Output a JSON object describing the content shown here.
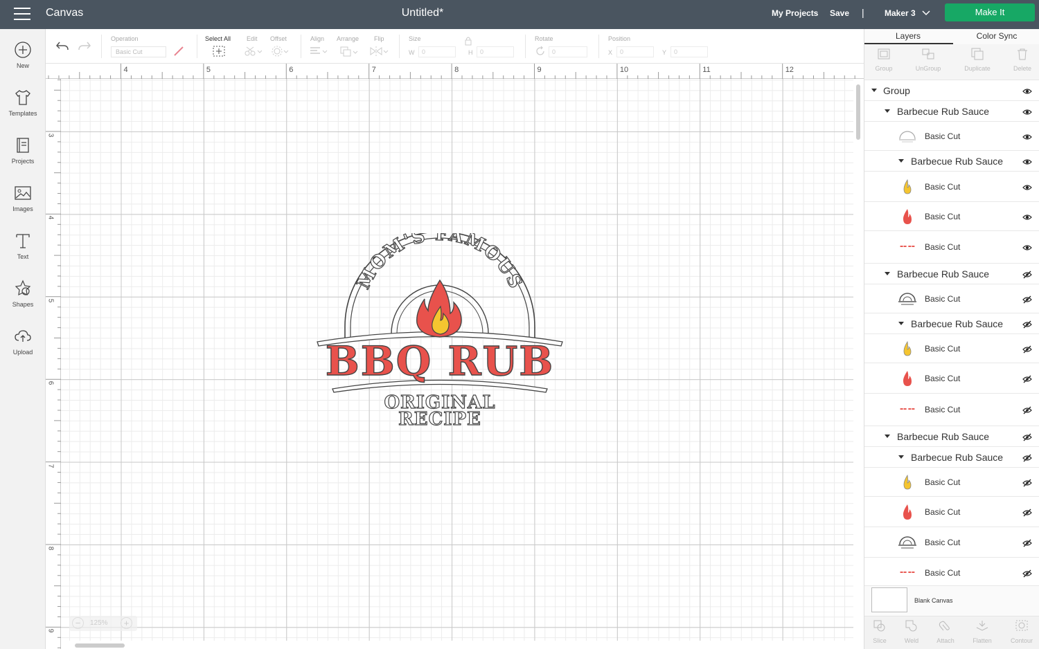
{
  "topbar": {
    "app_title": "Canvas",
    "doc_title": "Untitled*",
    "my_projects": "My Projects",
    "save": "Save",
    "separator": "|",
    "machine": "Maker 3",
    "make_it": "Make It",
    "make_it_color": "#17a865",
    "bar_color": "#4a5560"
  },
  "sidebar": {
    "items": [
      {
        "label": "New",
        "icon": "plus-circle-icon"
      },
      {
        "label": "Templates",
        "icon": "tshirt-icon"
      },
      {
        "label": "Projects",
        "icon": "book-icon"
      },
      {
        "label": "Images",
        "icon": "image-icon"
      },
      {
        "label": "Text",
        "icon": "text-t-icon"
      },
      {
        "label": "Shapes",
        "icon": "shapes-icon"
      },
      {
        "label": "Upload",
        "icon": "cloud-upload-icon"
      }
    ]
  },
  "toolbar": {
    "operation_label": "Operation",
    "operation_value": "Basic Cut",
    "select_all": "Select All",
    "edit": "Edit",
    "offset": "Offset",
    "align": "Align",
    "arrange": "Arrange",
    "flip": "Flip",
    "size": "Size",
    "w_label": "W",
    "w_value": "0",
    "h_label": "H",
    "h_value": "0",
    "rotate": "Rotate",
    "rotate_value": "0",
    "position": "Position",
    "x_label": "X",
    "x_value": "0",
    "y_label": "Y",
    "y_value": "0"
  },
  "canvas": {
    "ruler_top": [
      "4",
      "5",
      "6",
      "7",
      "8",
      "9",
      "10",
      "11",
      "12"
    ],
    "ruler_left": [
      "3",
      "4",
      "5",
      "6",
      "7",
      "8",
      "9"
    ],
    "zoom": "125%",
    "zoom_minus": "−",
    "zoom_plus": "+",
    "design": {
      "arc_text": "MOM'S FAMOUS",
      "main_text": "BBQ RUB",
      "sub_text_1": "ORIGINAL",
      "sub_text_2": "RECIPE",
      "red": "#e8524c",
      "yellow": "#f5c530"
    }
  },
  "panel": {
    "tab_layers": "Layers",
    "tab_color_sync": "Color Sync",
    "actions": [
      "Group",
      "UnGroup",
      "Duplicate",
      "Delete"
    ],
    "layers": [
      {
        "name": "Group",
        "indent": 0,
        "type": "group",
        "visible": true
      },
      {
        "name": "Barbecue Rub Sauce",
        "indent": 1,
        "type": "group",
        "visible": true
      },
      {
        "name": "Basic Cut",
        "indent": 2,
        "type": "arch-white",
        "visible": true
      },
      {
        "name": "Barbecue Rub Sauce",
        "indent": 2,
        "type": "group",
        "visible": true
      },
      {
        "name": "Basic Cut",
        "indent": 2,
        "type": "flame-yellow",
        "visible": true
      },
      {
        "name": "Basic Cut",
        "indent": 2,
        "type": "flame-red",
        "visible": true
      },
      {
        "name": "Basic Cut",
        "indent": 2,
        "type": "text-red",
        "visible": true
      },
      {
        "name": "Barbecue Rub Sauce",
        "indent": 1,
        "type": "group",
        "visible": false
      },
      {
        "name": "Basic Cut",
        "indent": 2,
        "type": "arch-gray",
        "visible": false
      },
      {
        "name": "Barbecue Rub Sauce",
        "indent": 2,
        "type": "group",
        "visible": false
      },
      {
        "name": "Basic Cut",
        "indent": 2,
        "type": "flame-yellow",
        "visible": false
      },
      {
        "name": "Basic Cut",
        "indent": 2,
        "type": "flame-red",
        "visible": false
      },
      {
        "name": "Basic Cut",
        "indent": 2,
        "type": "text-red",
        "visible": false
      },
      {
        "name": "Barbecue Rub Sauce",
        "indent": 1,
        "type": "group",
        "visible": false
      },
      {
        "name": "Barbecue Rub Sauce",
        "indent": 2,
        "type": "group",
        "visible": false
      },
      {
        "name": "Basic Cut",
        "indent": 2,
        "type": "flame-yellow",
        "visible": false
      },
      {
        "name": "Basic Cut",
        "indent": 2,
        "type": "flame-red",
        "visible": false
      },
      {
        "name": "Basic Cut",
        "indent": 2,
        "type": "arch-gray",
        "visible": false
      },
      {
        "name": "Basic Cut",
        "indent": 2,
        "type": "text-red",
        "visible": false
      }
    ],
    "blank_canvas": "Blank Canvas",
    "bottom_actions": [
      "Slice",
      "Weld",
      "Attach",
      "Flatten",
      "Contour"
    ]
  }
}
